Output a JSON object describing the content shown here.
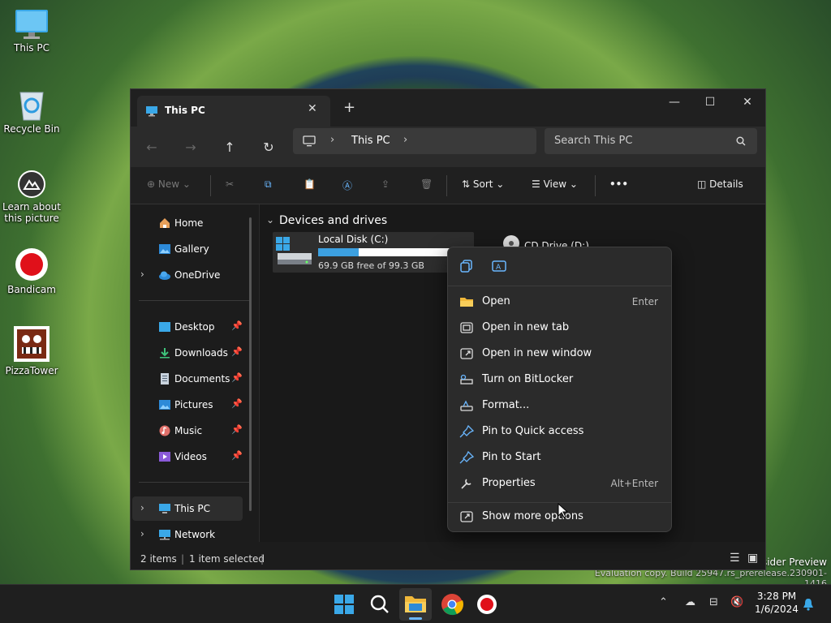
{
  "desktop": {
    "icons": [
      {
        "label": "This PC"
      },
      {
        "label": "Recycle Bin"
      },
      {
        "label": "Learn about this picture"
      },
      {
        "label": "Bandicam"
      },
      {
        "label": "PizzaTower"
      }
    ]
  },
  "window": {
    "tab_title": "This PC",
    "address": {
      "crumb": "This PC",
      "search_placeholder": "Search This PC"
    },
    "toolbar": {
      "new_label": "New",
      "sort_label": "Sort",
      "view_label": "View",
      "details_label": "Details",
      "more_label": "•••"
    },
    "sidebar": {
      "items": [
        {
          "label": "Home"
        },
        {
          "label": "Gallery"
        },
        {
          "label": "OneDrive"
        },
        {
          "label": "Desktop"
        },
        {
          "label": "Downloads"
        },
        {
          "label": "Documents"
        },
        {
          "label": "Pictures"
        },
        {
          "label": "Music"
        },
        {
          "label": "Videos"
        },
        {
          "label": "This PC"
        },
        {
          "label": "Network"
        }
      ]
    },
    "content": {
      "group_title": "Devices and drives",
      "drive": {
        "name": "Local Disk (C:)",
        "free_text": "69.9 GB free of 99.3 GB",
        "used_fraction": 0.296
      },
      "cd_name": "CD Drive (D:)"
    },
    "status": {
      "items_count": "2 items",
      "selected": "1 item selected"
    }
  },
  "context_menu": {
    "items": [
      {
        "label": "Open",
        "shortcut": "Enter"
      },
      {
        "label": "Open in new tab",
        "shortcut": ""
      },
      {
        "label": "Open in new window",
        "shortcut": ""
      },
      {
        "label": "Turn on BitLocker",
        "shortcut": ""
      },
      {
        "label": "Format...",
        "shortcut": ""
      },
      {
        "label": "Pin to Quick access",
        "shortcut": ""
      },
      {
        "label": "Pin to Start",
        "shortcut": ""
      },
      {
        "label": "Properties",
        "shortcut": "Alt+Enter"
      },
      {
        "label": "Show more options",
        "shortcut": ""
      }
    ]
  },
  "watermark": {
    "line1": "Insider Preview",
    "line2": "Evaluation copy. Build 25947.rs_prerelease.230901-1416"
  },
  "taskbar": {
    "time": "3:28 PM",
    "date": "1/6/2024"
  }
}
